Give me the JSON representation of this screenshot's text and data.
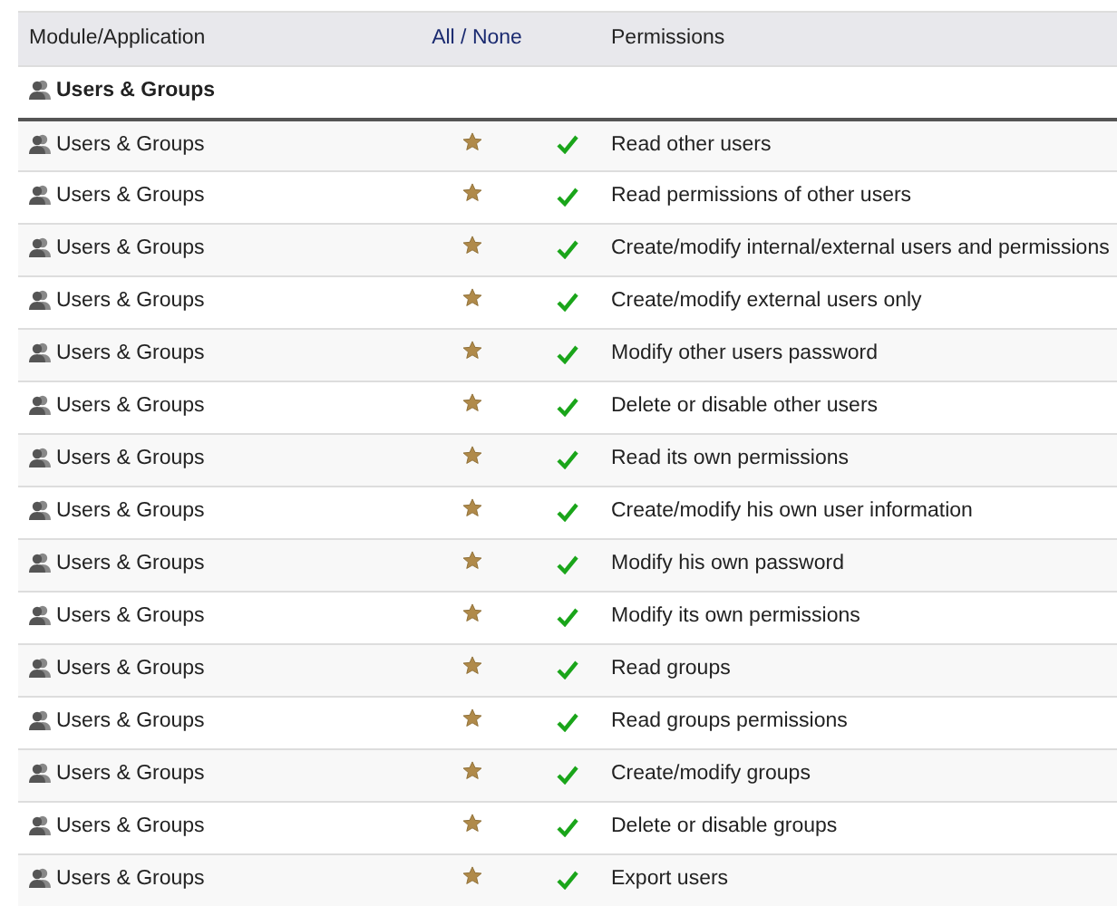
{
  "header": {
    "module": "Module/Application",
    "all": "All",
    "separator": " / ",
    "none": "None",
    "permissions": "Permissions"
  },
  "group": {
    "title": "Users & Groups"
  },
  "rows": [
    {
      "module": "Users & Groups",
      "default": true,
      "granted": true,
      "permission": "Read other users"
    },
    {
      "module": "Users & Groups",
      "default": true,
      "granted": true,
      "permission": "Read permissions of other users"
    },
    {
      "module": "Users & Groups",
      "default": true,
      "granted": true,
      "permission": "Create/modify internal/external users and permissions"
    },
    {
      "module": "Users & Groups",
      "default": true,
      "granted": true,
      "permission": "Create/modify external users only"
    },
    {
      "module": "Users & Groups",
      "default": true,
      "granted": true,
      "permission": "Modify other users password"
    },
    {
      "module": "Users & Groups",
      "default": true,
      "granted": true,
      "permission": "Delete or disable other users"
    },
    {
      "module": "Users & Groups",
      "default": true,
      "granted": true,
      "permission": "Read its own permissions"
    },
    {
      "module": "Users & Groups",
      "default": true,
      "granted": true,
      "permission": "Create/modify his own user information"
    },
    {
      "module": "Users & Groups",
      "default": true,
      "granted": true,
      "permission": "Modify his own password"
    },
    {
      "module": "Users & Groups",
      "default": true,
      "granted": true,
      "permission": "Modify its own permissions"
    },
    {
      "module": "Users & Groups",
      "default": true,
      "granted": true,
      "permission": "Read groups"
    },
    {
      "module": "Users & Groups",
      "default": true,
      "granted": true,
      "permission": "Read groups permissions"
    },
    {
      "module": "Users & Groups",
      "default": true,
      "granted": true,
      "permission": "Create/modify groups"
    },
    {
      "module": "Users & Groups",
      "default": true,
      "granted": true,
      "permission": "Delete or disable groups"
    },
    {
      "module": "Users & Groups",
      "default": true,
      "granted": true,
      "permission": "Export users"
    }
  ]
}
